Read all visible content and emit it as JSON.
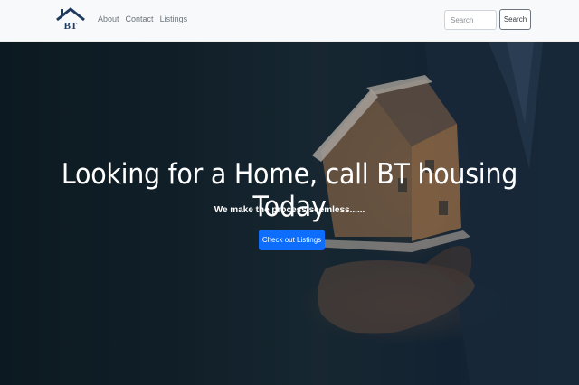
{
  "brand": {
    "logo_text": "BT",
    "logo_color": "#1f3a5f"
  },
  "nav": {
    "links": [
      {
        "label": "About"
      },
      {
        "label": "Contact"
      },
      {
        "label": "Listings"
      }
    ]
  },
  "search": {
    "placeholder": "Search",
    "button_label": "Search"
  },
  "hero": {
    "title": "Looking for a Home, call BT housing Today",
    "subtitle": "We make the process seemless......",
    "cta_label": "Check out Listings",
    "cta_color": "#0d6efd"
  }
}
